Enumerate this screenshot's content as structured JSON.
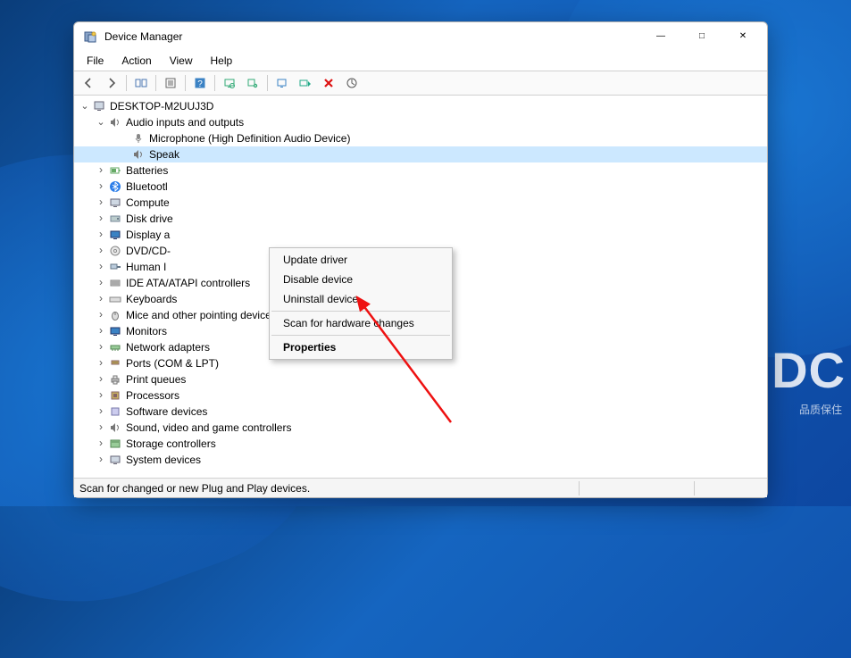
{
  "window": {
    "title": "Device Manager"
  },
  "menu": {
    "file": "File",
    "action": "Action",
    "view": "View",
    "help": "Help"
  },
  "statusbar": {
    "text": "Scan for changed or new Plug and Play devices."
  },
  "tree": {
    "root": "DESKTOP-M2UUJ3D",
    "audio": {
      "label": "Audio inputs and outputs",
      "mic": "Microphone (High Definition Audio Device)",
      "spk": "Speak"
    },
    "categories": {
      "batteries": "Batteries",
      "bluetooth": "Bluetootl",
      "computer": "Compute",
      "diskdrives": "Disk drive",
      "display": "Display a",
      "dvd": "DVD/CD-",
      "hid": "Human I",
      "ide": "IDE ATA/ATAPI controllers",
      "keyboards": "Keyboards",
      "mice": "Mice and other pointing devices",
      "monitors": "Monitors",
      "network": "Network adapters",
      "ports": "Ports (COM & LPT)",
      "printq": "Print queues",
      "processors": "Processors",
      "softdev": "Software devices",
      "sound": "Sound, video and game controllers",
      "storage": "Storage controllers",
      "sysdev": "System devices"
    }
  },
  "context_menu": {
    "update": "Update driver",
    "disable": "Disable device",
    "uninstall": "Uninstall device",
    "scan": "Scan for hardware changes",
    "properties": "Properties"
  },
  "watermark": {
    "main": "IDC",
    "sub": "品质保住"
  }
}
